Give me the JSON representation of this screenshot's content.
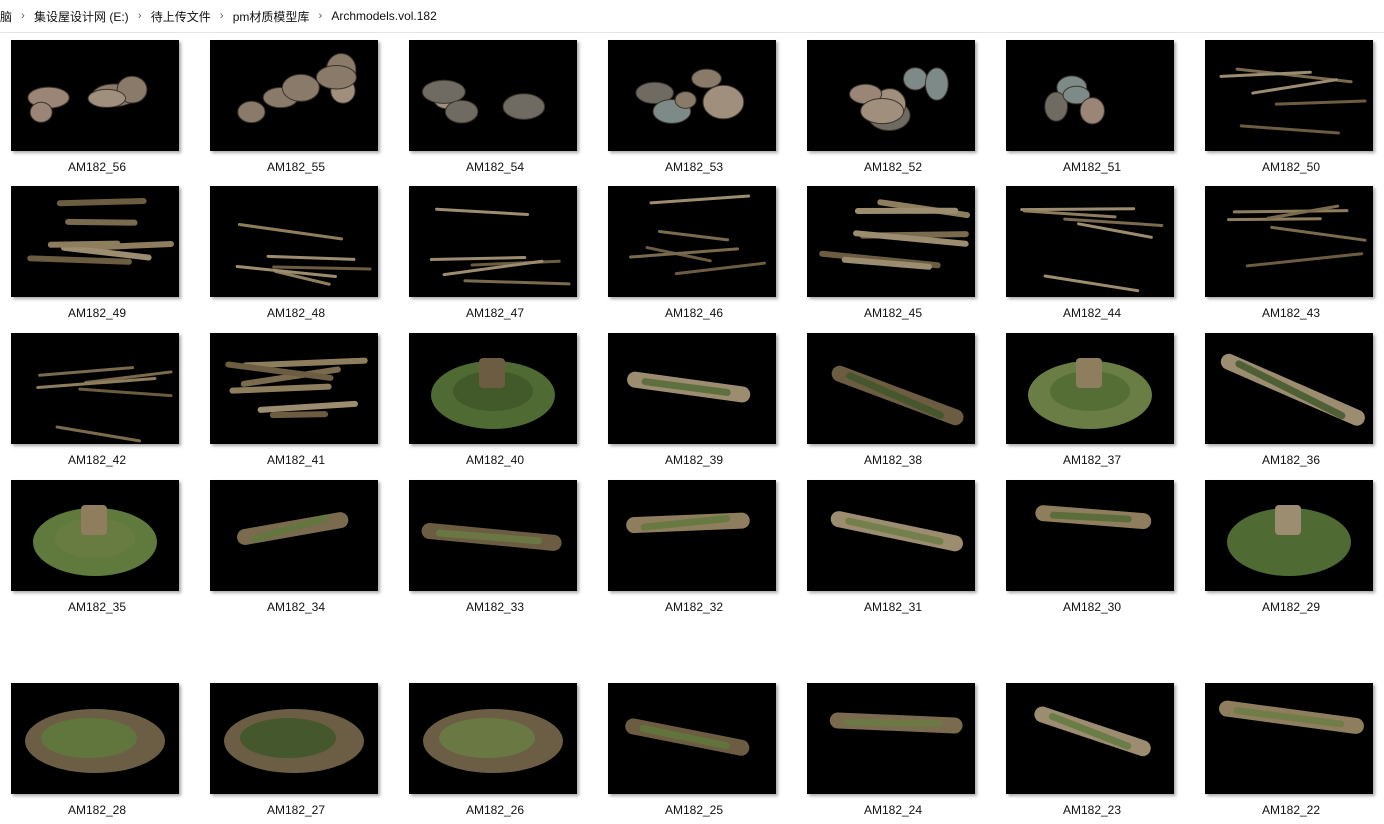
{
  "breadcrumb": [
    "脑",
    "集设屋设计网 (E:)",
    "待上传文件",
    "pm材质模型库",
    "Archmodels.vol.182"
  ],
  "files": [
    {
      "name": "AM182_56",
      "kind": "rocks"
    },
    {
      "name": "AM182_55",
      "kind": "rocks"
    },
    {
      "name": "AM182_54",
      "kind": "rocks"
    },
    {
      "name": "AM182_53",
      "kind": "rocks"
    },
    {
      "name": "AM182_52",
      "kind": "rocks"
    },
    {
      "name": "AM182_51",
      "kind": "rocks"
    },
    {
      "name": "AM182_50",
      "kind": "twigs"
    },
    {
      "name": "AM182_49",
      "kind": "branches"
    },
    {
      "name": "AM182_48",
      "kind": "twigs"
    },
    {
      "name": "AM182_47",
      "kind": "twigs"
    },
    {
      "name": "AM182_46",
      "kind": "twigs"
    },
    {
      "name": "AM182_45",
      "kind": "branches"
    },
    {
      "name": "AM182_44",
      "kind": "twigs"
    },
    {
      "name": "AM182_43",
      "kind": "twigs"
    },
    {
      "name": "AM182_42",
      "kind": "twigs"
    },
    {
      "name": "AM182_41",
      "kind": "branches"
    },
    {
      "name": "AM182_40",
      "kind": "stump"
    },
    {
      "name": "AM182_39",
      "kind": "log"
    },
    {
      "name": "AM182_38",
      "kind": "log"
    },
    {
      "name": "AM182_37",
      "kind": "stump"
    },
    {
      "name": "AM182_36",
      "kind": "log"
    },
    {
      "name": "AM182_35",
      "kind": "stump"
    },
    {
      "name": "AM182_34",
      "kind": "log"
    },
    {
      "name": "AM182_33",
      "kind": "log"
    },
    {
      "name": "AM182_32",
      "kind": "log"
    },
    {
      "name": "AM182_31",
      "kind": "log"
    },
    {
      "name": "AM182_30",
      "kind": "log"
    },
    {
      "name": "AM182_29",
      "kind": "stump"
    },
    {
      "name": "AM182_28",
      "kind": "patch"
    },
    {
      "name": "AM182_27",
      "kind": "patch"
    },
    {
      "name": "AM182_26",
      "kind": "patch"
    },
    {
      "name": "AM182_25",
      "kind": "log"
    },
    {
      "name": "AM182_24",
      "kind": "log"
    },
    {
      "name": "AM182_23",
      "kind": "log"
    },
    {
      "name": "AM182_22",
      "kind": "log"
    }
  ],
  "colors": {
    "rock": [
      "#8a7a6a",
      "#a08f7c",
      "#6f6a62",
      "#9a8576",
      "#7d8a88"
    ],
    "wood": [
      "#7a6a4e",
      "#8f7e5e",
      "#6b5c42",
      "#9c8c70"
    ],
    "moss": [
      "#4f6a33",
      "#5f7a3c",
      "#3e5628",
      "#6a7d44"
    ]
  }
}
